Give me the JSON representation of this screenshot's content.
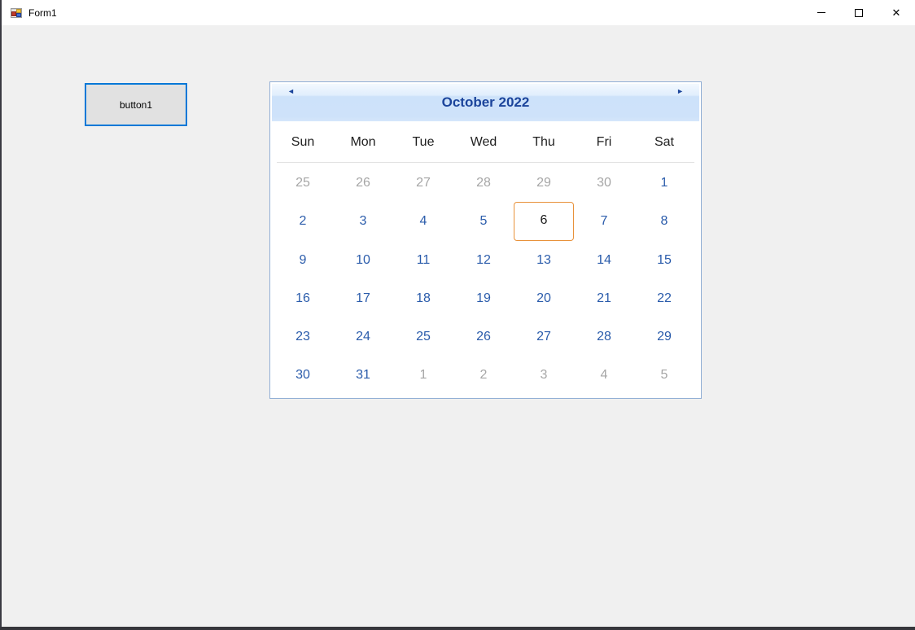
{
  "window": {
    "title": "Form1"
  },
  "icons": {
    "form": "winforms-default-form-icon",
    "minimize": "—",
    "maximize": "□",
    "close": "✕",
    "prev_month": "◄",
    "next_month": "►"
  },
  "button": {
    "label": "button1"
  },
  "calendar": {
    "title": "October 2022",
    "day_headers": [
      "Sun",
      "Mon",
      "Tue",
      "Wed",
      "Thu",
      "Fri",
      "Sat"
    ],
    "today_date": "6",
    "weeks": [
      [
        {
          "d": "25",
          "s": "prev"
        },
        {
          "d": "26",
          "s": "prev"
        },
        {
          "d": "27",
          "s": "prev"
        },
        {
          "d": "28",
          "s": "prev"
        },
        {
          "d": "29",
          "s": "prev"
        },
        {
          "d": "30",
          "s": "prev"
        },
        {
          "d": "1",
          "s": "cur"
        }
      ],
      [
        {
          "d": "2",
          "s": "cur"
        },
        {
          "d": "3",
          "s": "cur"
        },
        {
          "d": "4",
          "s": "cur"
        },
        {
          "d": "5",
          "s": "cur"
        },
        {
          "d": "6",
          "s": "today"
        },
        {
          "d": "7",
          "s": "cur"
        },
        {
          "d": "8",
          "s": "cur"
        }
      ],
      [
        {
          "d": "9",
          "s": "cur"
        },
        {
          "d": "10",
          "s": "cur"
        },
        {
          "d": "11",
          "s": "cur"
        },
        {
          "d": "12",
          "s": "cur"
        },
        {
          "d": "13",
          "s": "cur"
        },
        {
          "d": "14",
          "s": "cur"
        },
        {
          "d": "15",
          "s": "cur"
        }
      ],
      [
        {
          "d": "16",
          "s": "cur"
        },
        {
          "d": "17",
          "s": "cur"
        },
        {
          "d": "18",
          "s": "cur"
        },
        {
          "d": "19",
          "s": "cur"
        },
        {
          "d": "20",
          "s": "cur"
        },
        {
          "d": "21",
          "s": "cur"
        },
        {
          "d": "22",
          "s": "cur"
        }
      ],
      [
        {
          "d": "23",
          "s": "cur"
        },
        {
          "d": "24",
          "s": "cur"
        },
        {
          "d": "25",
          "s": "cur"
        },
        {
          "d": "26",
          "s": "cur"
        },
        {
          "d": "27",
          "s": "cur"
        },
        {
          "d": "28",
          "s": "cur"
        },
        {
          "d": "29",
          "s": "cur"
        }
      ],
      [
        {
          "d": "30",
          "s": "cur"
        },
        {
          "d": "31",
          "s": "cur"
        },
        {
          "d": "1",
          "s": "next"
        },
        {
          "d": "2",
          "s": "next"
        },
        {
          "d": "3",
          "s": "next"
        },
        {
          "d": "4",
          "s": "next"
        },
        {
          "d": "5",
          "s": "next"
        }
      ]
    ]
  },
  "colors": {
    "header_text": "#1B449B",
    "date": "#2B5CAB",
    "muted": "#A6A6A6",
    "today_border": "#E8923B",
    "button_focus_border": "#0078D7",
    "calendar_border": "#92AFD5",
    "form_background": "#F0F0F0"
  }
}
